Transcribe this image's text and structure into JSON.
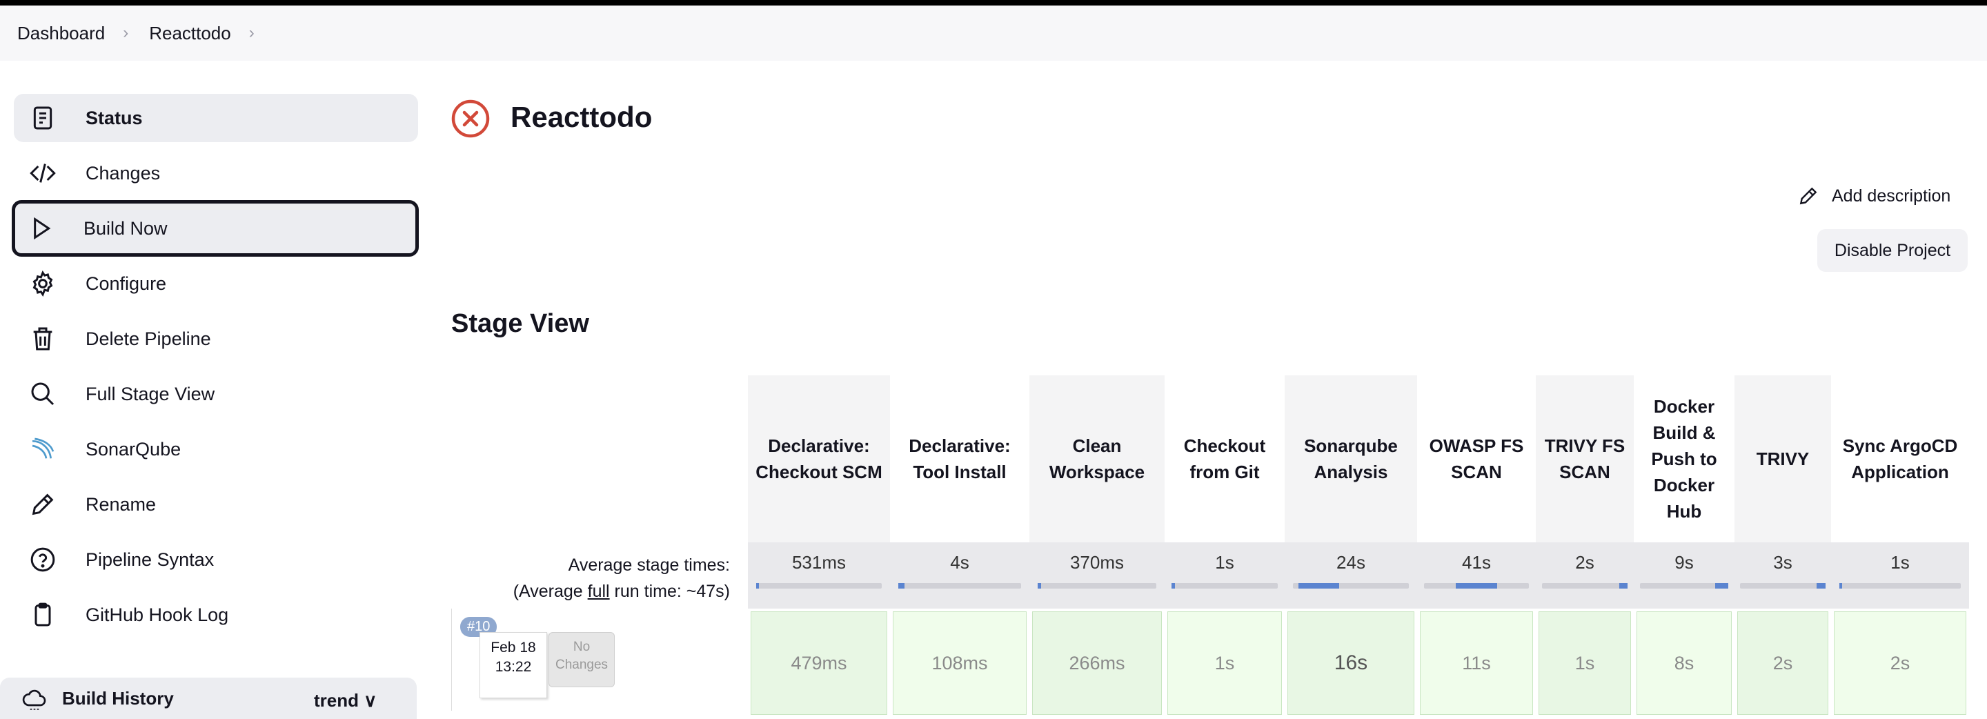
{
  "breadcrumbs": [
    "Dashboard",
    "Reacttodo"
  ],
  "sidebar": {
    "items": [
      {
        "label": "Status",
        "icon": "document-icon"
      },
      {
        "label": "Changes",
        "icon": "code-icon"
      },
      {
        "label": "Build Now",
        "icon": "play-icon"
      },
      {
        "label": "Configure",
        "icon": "gear-icon"
      },
      {
        "label": "Delete Pipeline",
        "icon": "trash-icon"
      },
      {
        "label": "Full Stage View",
        "icon": "search-icon"
      },
      {
        "label": "SonarQube",
        "icon": "sonarqube-icon"
      },
      {
        "label": "Rename",
        "icon": "pencil-icon"
      },
      {
        "label": "Pipeline Syntax",
        "icon": "help-icon"
      },
      {
        "label": "GitHub Hook Log",
        "icon": "clipboard-icon"
      }
    ],
    "build_history": {
      "label": "Build History",
      "trend": "trend"
    }
  },
  "main": {
    "title": "Reacttodo",
    "add_description": "Add description",
    "disable_project": "Disable Project",
    "stage_view_title": "Stage View",
    "avg_label_1": "Average stage times:",
    "avg_label_2_prefix": "(Average ",
    "avg_label_2_link": "full",
    "avg_label_2_suffix": " run time: ~47s)",
    "run": {
      "badge": "#10",
      "date": "Feb 18",
      "time": "13:22",
      "no_changes_1": "No",
      "no_changes_2": "Changes"
    }
  },
  "stages": [
    {
      "name": "Declarative: Checkout SCM",
      "avg": "531ms",
      "run": "479ms"
    },
    {
      "name": "Declarative: Tool Install",
      "avg": "4s",
      "run": "108ms"
    },
    {
      "name": "Clean Workspace",
      "avg": "370ms",
      "run": "266ms"
    },
    {
      "name": "Checkout from Git",
      "avg": "1s",
      "run": "1s"
    },
    {
      "name": "Sonarqube Analysis",
      "avg": "24s",
      "run": "16s"
    },
    {
      "name": "OWASP FS SCAN",
      "avg": "41s",
      "run": "11s"
    },
    {
      "name": "TRIVY FS SCAN",
      "avg": "2s",
      "run": "1s"
    },
    {
      "name": "Docker Build & Push to Docker Hub",
      "avg": "9s",
      "run": "8s"
    },
    {
      "name": "TRIVY",
      "avg": "3s",
      "run": "2s"
    },
    {
      "name": "Sync ArgoCD Application",
      "avg": "1s",
      "run": "2s"
    }
  ]
}
